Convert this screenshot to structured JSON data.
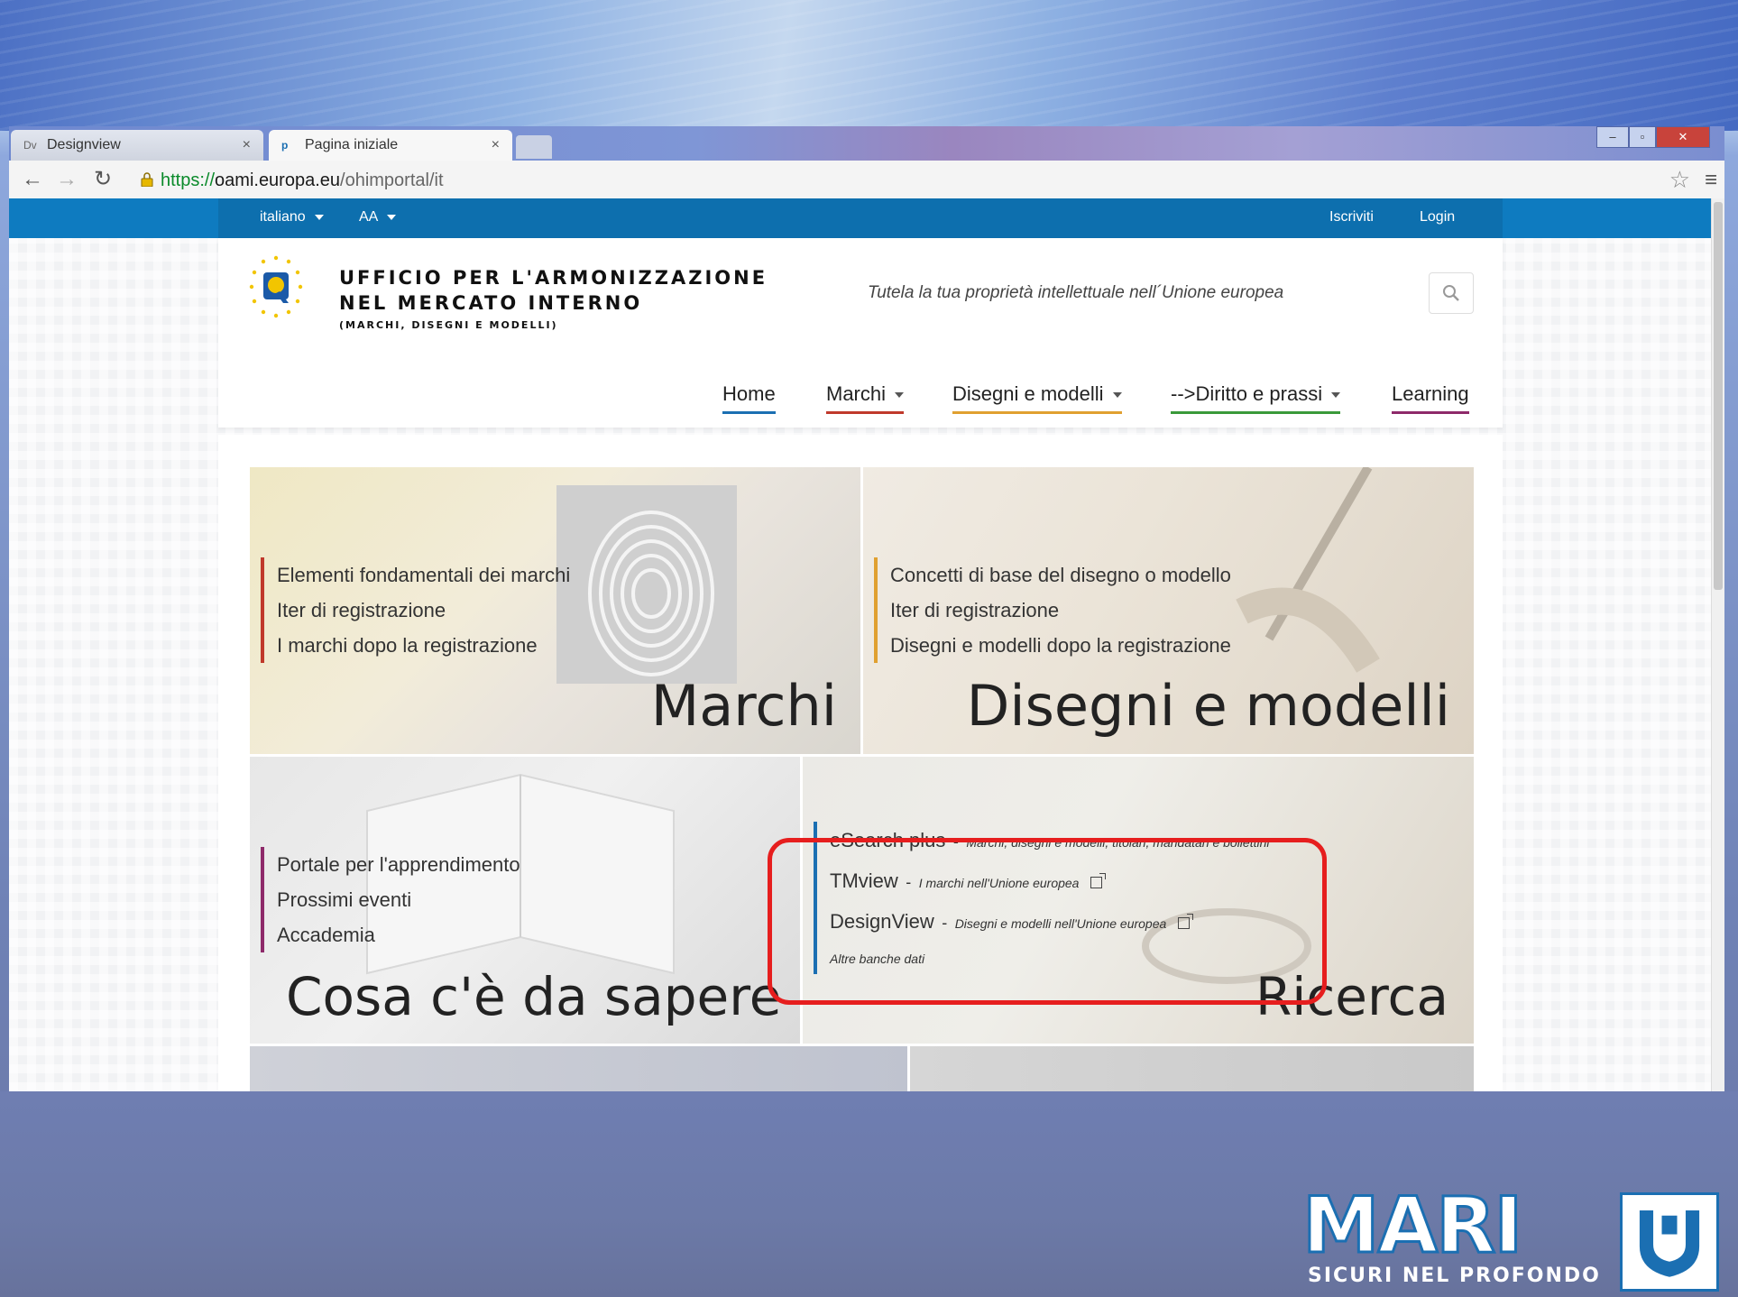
{
  "browser": {
    "tabs": [
      {
        "favicon": "Dv",
        "title": "Designview",
        "active": false
      },
      {
        "favicon": "p",
        "title": "Pagina iniziale",
        "active": true
      }
    ],
    "url_scheme": "https://",
    "url_host": "oami.europa.eu",
    "url_path": "/ohimportal/it",
    "icons": [
      "back-icon",
      "forward-icon",
      "reload-icon",
      "lock-icon",
      "star-icon",
      "menu-icon"
    ]
  },
  "topbar": {
    "language": "italiano",
    "font_size": "AA",
    "register": "Iscriviti",
    "login": "Login"
  },
  "header": {
    "org_line1": "UFFICIO PER L'ARMONIZZAZIONE",
    "org_line2": "NEL MERCATO INTERNO",
    "org_line3": "(MARCHI, DISEGNI E MODELLI)",
    "tagline": "Tutela la tua proprietà intellettuale nell´Unione europea"
  },
  "nav": {
    "items": [
      {
        "label": "Home",
        "dropdown": false,
        "color": "#1b6fb2"
      },
      {
        "label": "Marchi",
        "dropdown": true,
        "color": "#c0392b"
      },
      {
        "label": "Disegni e modelli",
        "dropdown": true,
        "color": "#e0a030"
      },
      {
        "label": "-->Diritto e prassi",
        "dropdown": true,
        "color": "#3a9a3a"
      },
      {
        "label": "Learning",
        "dropdown": false,
        "color": "#8e2a6a"
      }
    ]
  },
  "tiles": {
    "marchi": {
      "title": "Marchi",
      "accent": "#c0392b",
      "links": [
        "Elementi fondamentali dei marchi",
        "Iter di registrazione",
        "I marchi dopo la registrazione"
      ]
    },
    "disegni": {
      "title": "Disegni e modelli",
      "accent": "#e0a030",
      "links": [
        "Concetti di base del disegno o modello",
        "Iter di registrazione",
        "Disegni e modelli dopo la registrazione"
      ]
    },
    "sapere": {
      "title": "Cosa c'è da sapere",
      "accent": "#8e2a6a",
      "links": [
        "Portale per l'apprendimento",
        "Prossimi eventi",
        "Accademia"
      ]
    },
    "ricerca": {
      "title": "Ricerca",
      "accent": "#1b6fb2",
      "rows": [
        {
          "label": "eSearch plus",
          "desc": "Marchi, disegni e modelli, titolari, mandatari e bollettini",
          "external": false
        },
        {
          "label": "TMview",
          "desc": "I marchi nell'Unione europea",
          "external": true
        },
        {
          "label": "DesignView",
          "desc": "Disegni e modelli nell'Unione europea",
          "external": true
        }
      ],
      "more": "Altre banche dati",
      "separator": "-"
    }
  },
  "mari": {
    "word": "MARI",
    "slogan": "SICURI NEL PROFONDO"
  }
}
